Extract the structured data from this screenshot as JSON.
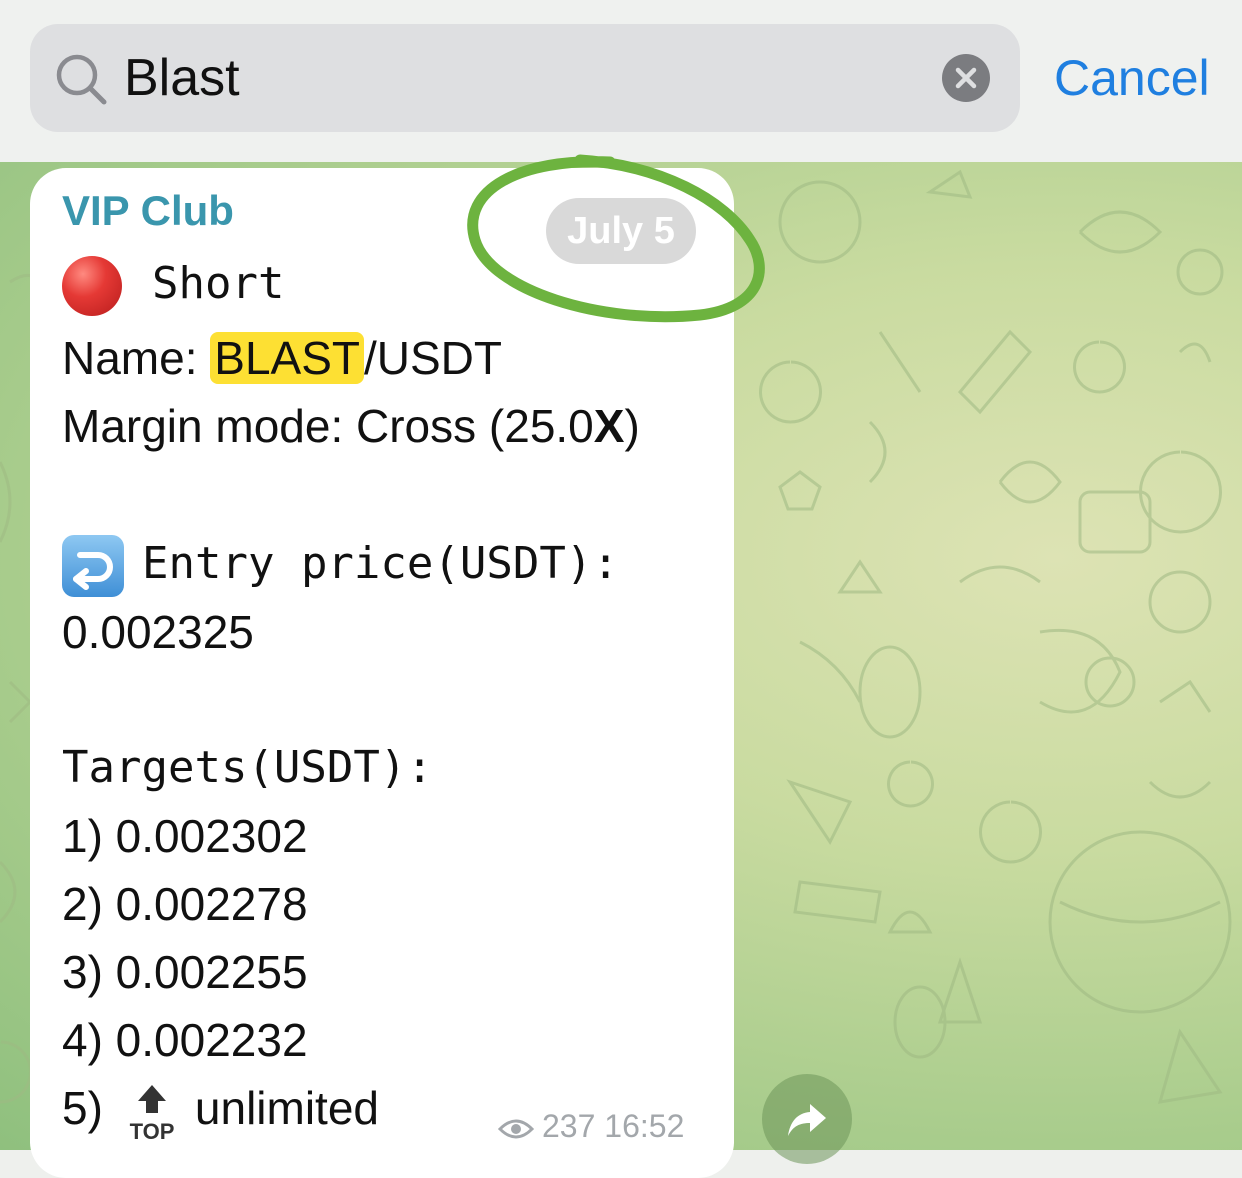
{
  "search": {
    "query": "Blast",
    "cancel_label": "Cancel"
  },
  "message": {
    "channel": "VIP Club",
    "date_badge": "July 5",
    "direction": "Short",
    "name_label": "Name: ",
    "pair_highlight": "BLAST",
    "pair_rest": "/USDT",
    "margin_prefix": "Margin mode: Cross (25.0",
    "margin_x": "X",
    "margin_suffix": ")",
    "entry_label": "Entry price(USDT):",
    "entry_value": "0.002325",
    "targets_label": "Targets(USDT):",
    "targets": [
      "1) 0.002302",
      "2) 0.002278",
      "3) 0.002255",
      "4) 0.002232"
    ],
    "target5_prefix": "5)",
    "target5_value": "unlimited",
    "views": "237",
    "time": "16:52"
  },
  "icons": {
    "search": "search-icon",
    "clear": "clear-icon",
    "direction": "red-circle-icon",
    "entry": "right-arrow-curving-left-icon",
    "top": "top-arrow-icon",
    "views": "eye-icon",
    "share": "share-arrow-icon"
  },
  "colors": {
    "accent": "#1f7fe0",
    "channel": "#3a96ad",
    "highlight": "#fde033",
    "annotation": "#6db33f"
  }
}
